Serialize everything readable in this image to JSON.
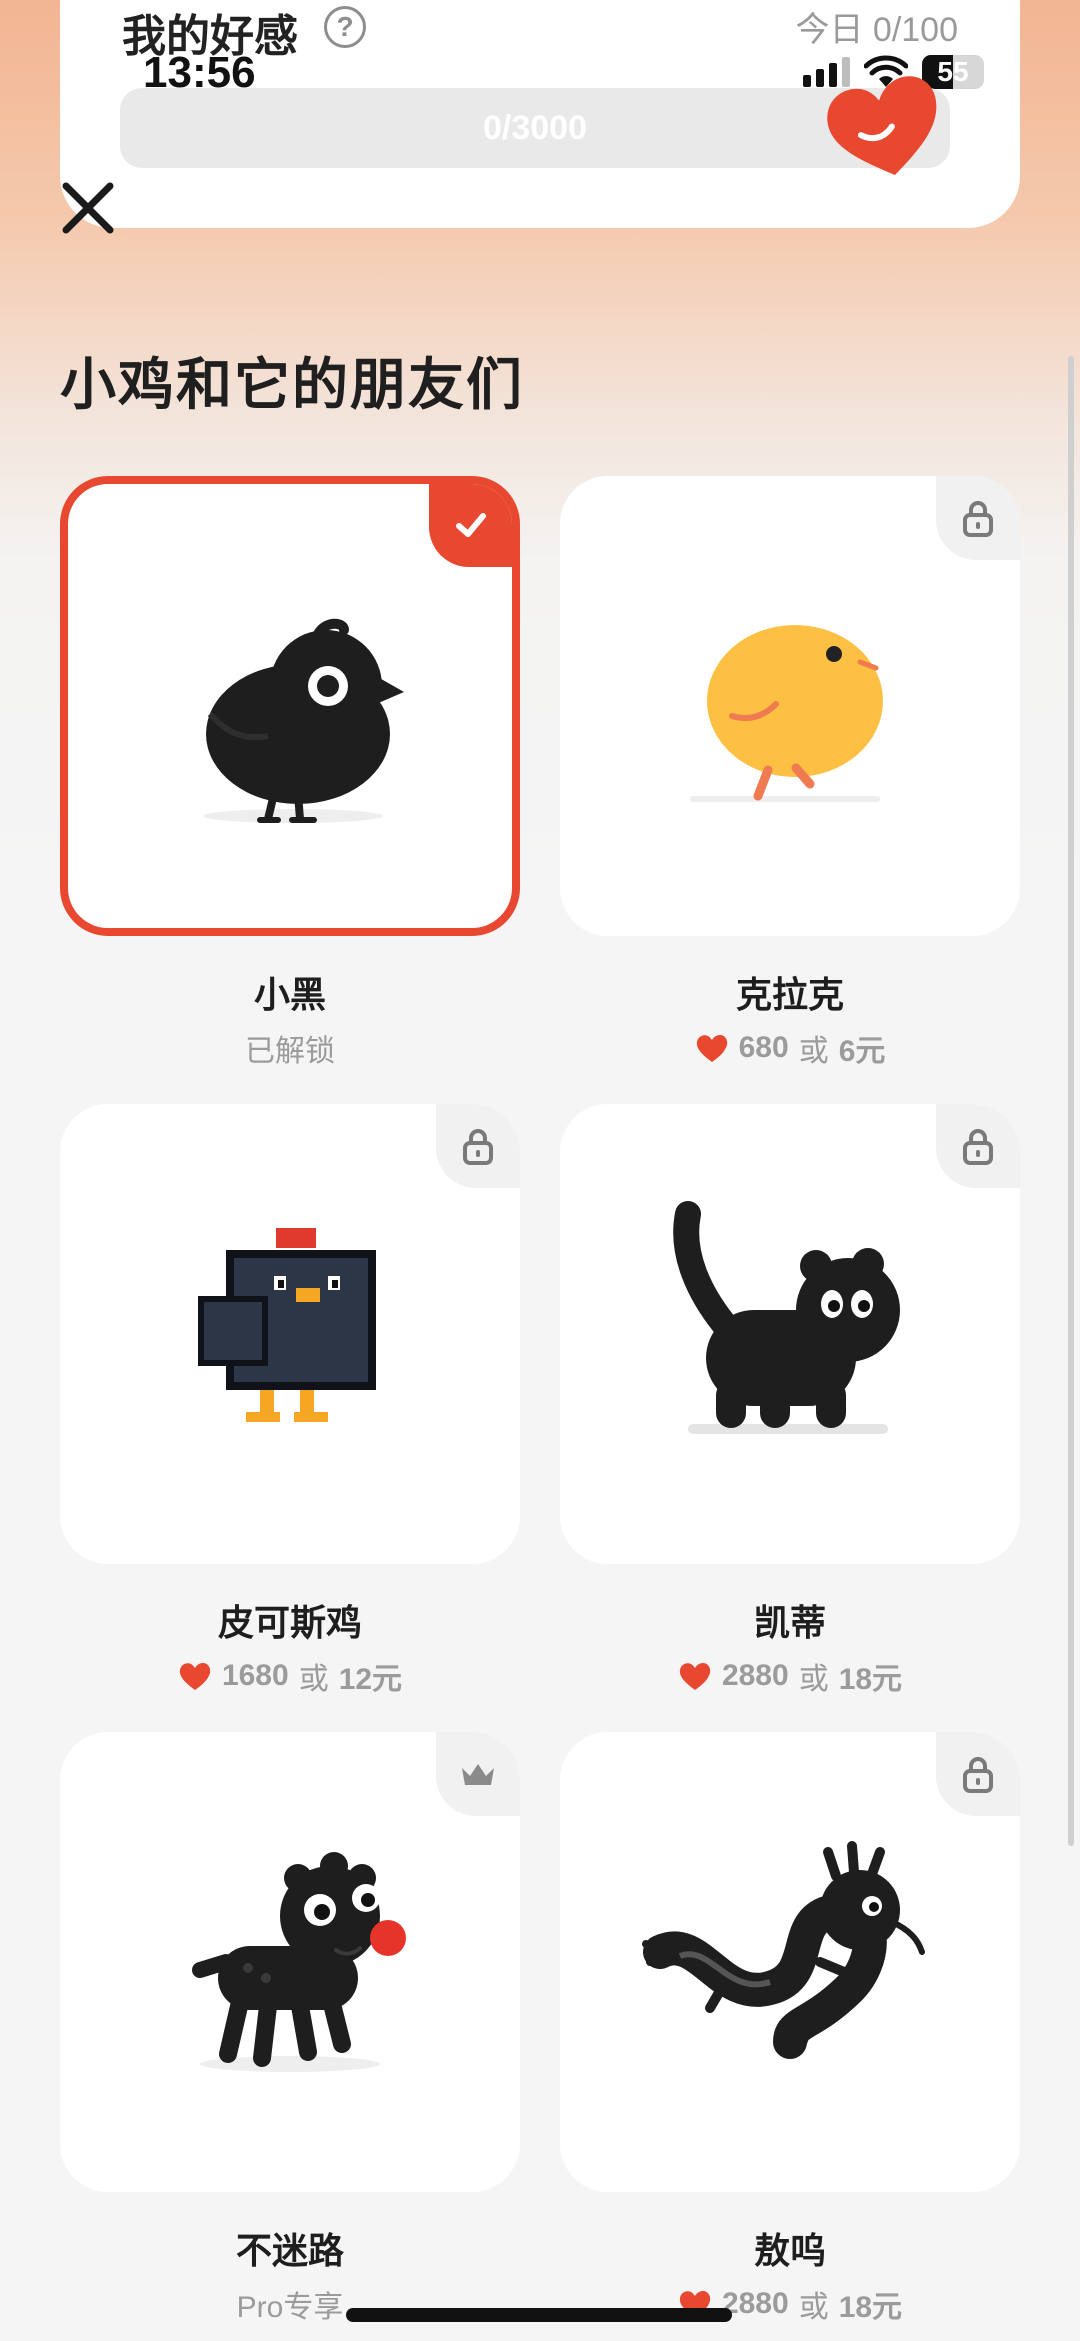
{
  "header": {
    "title": "我的好感",
    "help_icon": "?",
    "today": "今日 0/100",
    "progress": {
      "label": "0/3000",
      "value": 0,
      "max": 3000
    },
    "heart_color": "#e8482f"
  },
  "status_bar": {
    "time": "13:56",
    "battery": "55"
  },
  "section_title": "小鸡和它的朋友们",
  "items": [
    {
      "name": "小黑",
      "status": "已解锁",
      "selected": true,
      "corner_icon": "check-icon"
    },
    {
      "name": "克拉克",
      "price": "680",
      "or": "或",
      "money": "6元",
      "corner_icon": "lock-icon"
    },
    {
      "name": "皮可斯鸡",
      "price": "1680",
      "or": "或",
      "money": "12元",
      "corner_icon": "lock-icon"
    },
    {
      "name": "凯蒂",
      "price": "2880",
      "or": "或",
      "money": "18元",
      "corner_icon": "lock-icon"
    },
    {
      "name": "不迷路",
      "status": "Pro专享",
      "corner_icon": "crown-icon"
    },
    {
      "name": "敖呜",
      "price": "2880",
      "or": "或",
      "money": "18元",
      "corner_icon": "lock-icon"
    }
  ],
  "colors": {
    "accent": "#e8482f",
    "muted": "#9b9b9b"
  }
}
